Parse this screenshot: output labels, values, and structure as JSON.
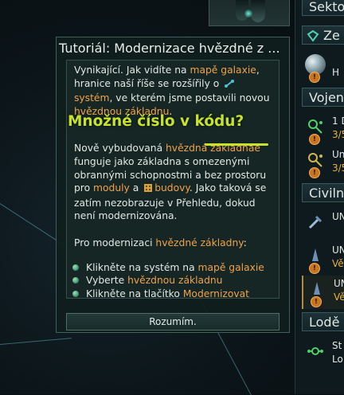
{
  "dialog": {
    "title": "Tutoriál: Modernizace hvězdné z ...",
    "p1": {
      "a": "Vynikající. Jak vidíte na ",
      "b": "mapě galaxie",
      "c": ", hranice naší říše se rozšířily o ",
      "d": "systém",
      "e": ", ve kterém jsme postavili novou ",
      "f": "hvězdnou základnu",
      "g": "."
    },
    "p2": {
      "a": "Nově vybudovaná ",
      "b": "hvězdná základnae",
      "c": " funguje jako základna s omezenými obrannými schopnostmi a bez prostoru pro ",
      "d": "moduly",
      "e": " a ",
      "f": "budovy",
      "g": ". Jako taková se zatím nezobrazuje v Přehledu, dokud není modernizována."
    },
    "p3": {
      "a": "Pro modernizaci ",
      "b": "hvězdné základny",
      "c": ":"
    },
    "steps": [
      {
        "a": "Klikněte na systém na ",
        "b": "mapě galaxie"
      },
      {
        "a": "Vyberte ",
        "b": "hvězdnou základnu"
      },
      {
        "a": "Klikněte na tlačítko ",
        "b": "Modernizovat"
      }
    ],
    "ok_label": "Rozumím."
  },
  "overlay": {
    "label": "Množné číslo v kódu?"
  },
  "outliner": {
    "headers": [
      "Sektor",
      "Ze",
      "Vojen",
      "Civilní",
      "Lodě"
    ],
    "rows": [
      {
        "t1": "H",
        "t2": ""
      },
      {
        "t1": "1 D",
        "t2": "3/5"
      },
      {
        "t1": "Un",
        "t2": "3/5"
      },
      {
        "t1": "UN",
        "t2": ""
      },
      {
        "t1": "UN",
        "t2": "Vě"
      },
      {
        "t1": "UN",
        "t2": "Vě"
      },
      {
        "t1": "St",
        "t2": "Lo"
      }
    ]
  },
  "colors": {
    "highlight": "#f0a24a",
    "annotation": "#c7e22a",
    "panel_border": "#3f5f58"
  }
}
